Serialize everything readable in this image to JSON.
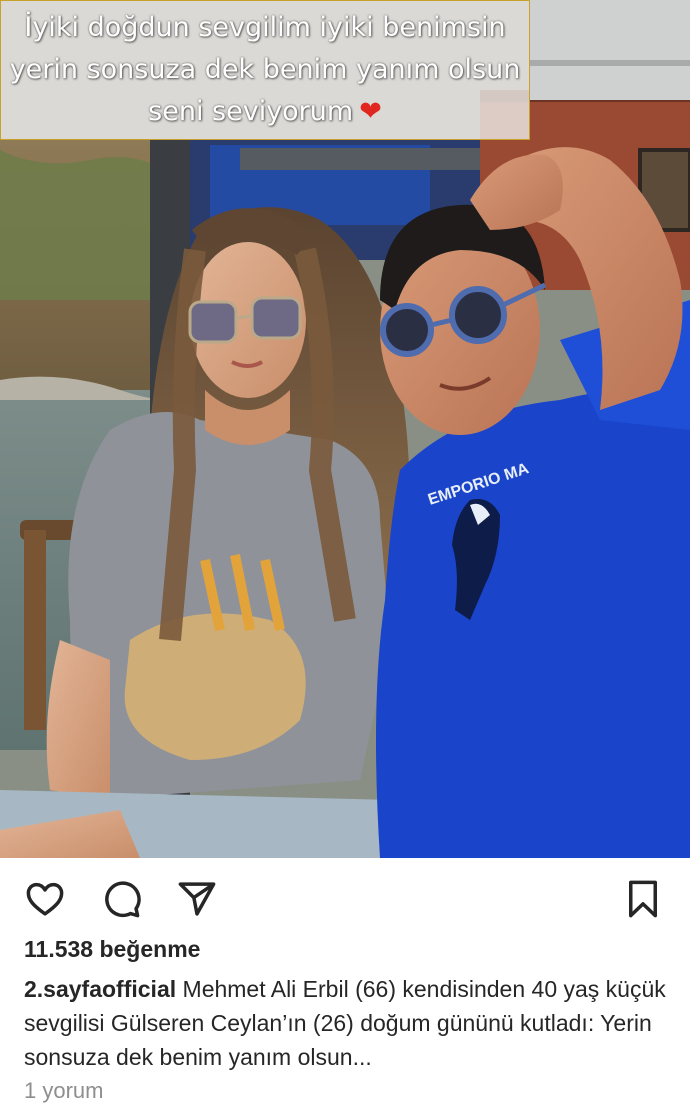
{
  "story_caption": {
    "line1": "İyiki doğdun sevgilim iyiki benimsin",
    "line2": "yerin sonsuza dek benim yanım olsun",
    "line3": "seni seviyorum",
    "emoji": "red-heart-icon"
  },
  "photo": {
    "shirt_text": "EMPORIO   MA"
  },
  "actions": {
    "like_icon": "heart-icon",
    "comment_icon": "comment-icon",
    "share_icon": "send-icon",
    "save_icon": "bookmark-icon"
  },
  "likes": {
    "text": "11.538 beğenme"
  },
  "caption": {
    "username": "2.sayfaofficial",
    "text": "Mehmet Ali Erbil (66) kendisinden 40 yaş küçük sevgilisi Gülseren Ceylan’ın (26) doğum gününü kutladı: Yerin sonsuza dek benim yanım olsun..."
  },
  "comments": {
    "text": "1 yorum"
  },
  "colors": {
    "text_primary": "#262626",
    "text_secondary": "#8e8e8e",
    "heart": "#e0261e",
    "shirt_blue": "#1a44c9",
    "caption_border": "#c7a12a"
  }
}
